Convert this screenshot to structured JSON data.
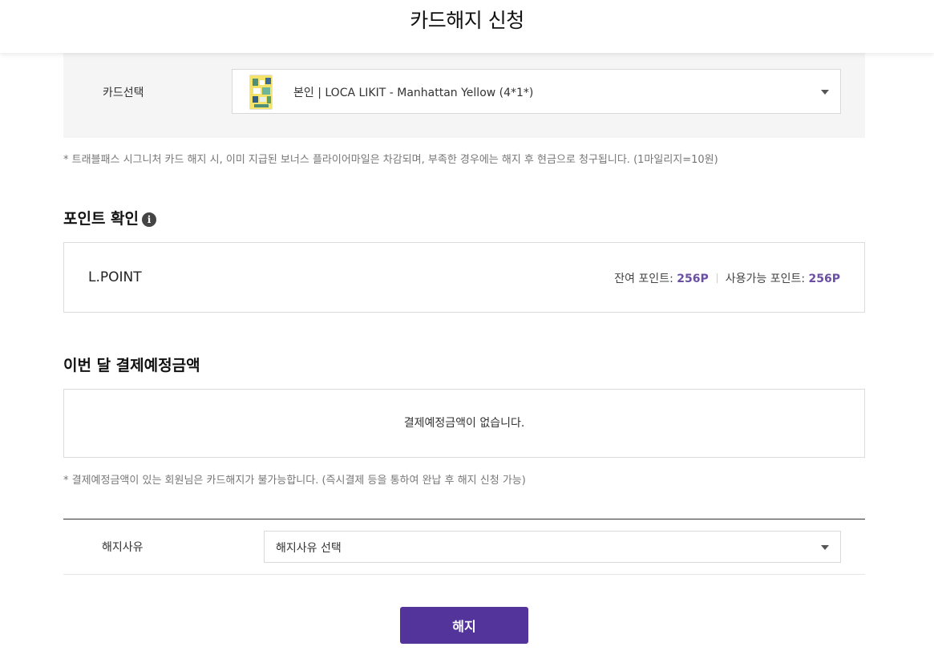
{
  "header": {
    "title": "카드해지 신청"
  },
  "card_section": {
    "label": "카드선택",
    "selected": "본인 | LOCA LIKIT - Manhattan Yellow (4*1*)",
    "thumb_icon": "card-thumbnail-image"
  },
  "notes": {
    "bonus": "* 트래블패스 시그니처 카드 해지 시, 이미 지급된 보너스 플라이어마일은 차감되며, 부족한 경우에는 해지 후 현금으로 청구됩니다. (1마일리지=10원)",
    "payment": "* 결제예정금액이 있는 회원님은 카드해지가 불가능합니다. (즉시결제 등을 통하여 완납 후 해지 신청 가능)"
  },
  "points": {
    "title": "포인트 확인",
    "info_icon": "i",
    "name": "L.POINT",
    "remaining_label": "잔여 포인트: ",
    "remaining_value": "256P",
    "available_label": "사용가능 포인트: ",
    "available_value": "256P"
  },
  "payment": {
    "title": "이번 달 결제예정금액",
    "empty_message": "결제예정금액이 없습니다."
  },
  "reason": {
    "label": "해지사유",
    "placeholder": "해지사유 선택"
  },
  "actions": {
    "cancel_label": "해지"
  },
  "colors": {
    "accent": "#52349b",
    "point_value": "#6a4fa3",
    "panel_bg": "#f5f5f5"
  }
}
